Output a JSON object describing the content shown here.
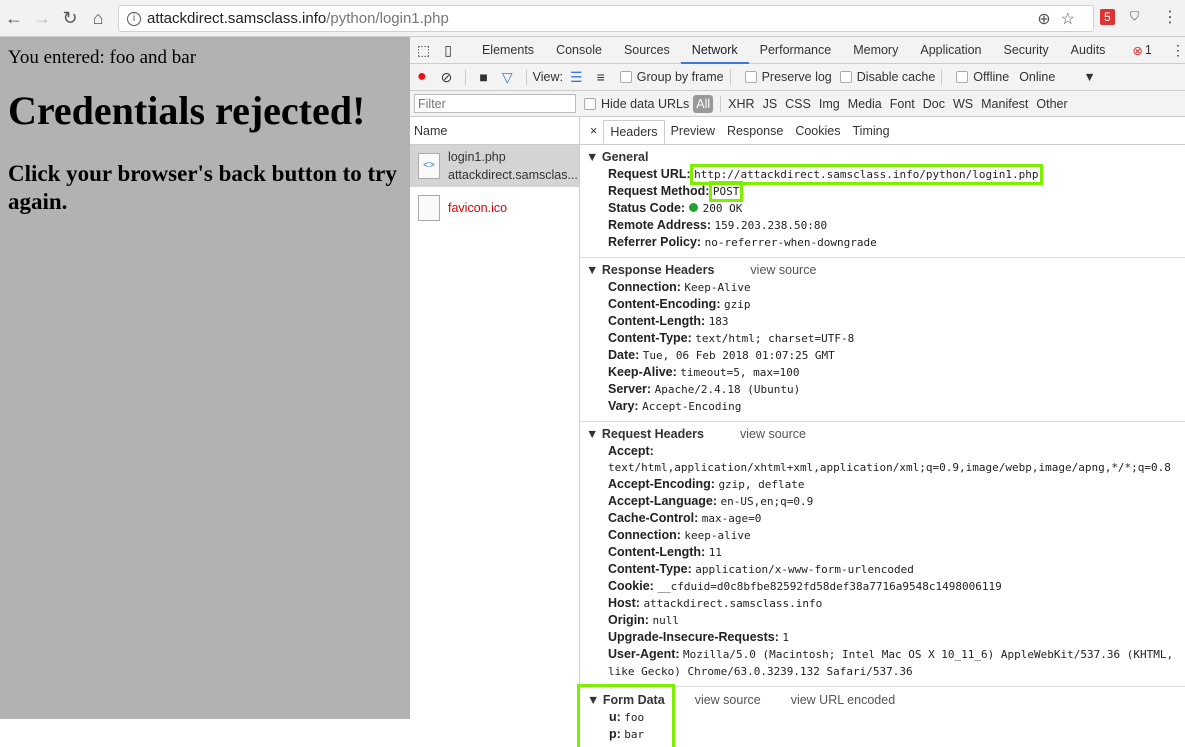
{
  "browser": {
    "url_host": "attackdirect.samsclass.info",
    "url_path": "/python/login1.php",
    "ext_badge": "5"
  },
  "page": {
    "entered": "You entered: foo and bar",
    "heading": "Credentials rejected!",
    "hint": "Click your browser's back button to try again."
  },
  "devtools": {
    "tabs": [
      "Elements",
      "Console",
      "Sources",
      "Network",
      "Performance",
      "Memory",
      "Application",
      "Security",
      "Audits"
    ],
    "error_count": "1",
    "toolbar": {
      "view": "View:",
      "group_by_frame": "Group by frame",
      "preserve_log": "Preserve log",
      "disable_cache": "Disable cache",
      "offline": "Offline",
      "throttle": "Online"
    },
    "filter_placeholder": "Filter",
    "hide_data_urls": "Hide data URLs",
    "filter_types": [
      "All",
      "XHR",
      "JS",
      "CSS",
      "Img",
      "Media",
      "Font",
      "Doc",
      "WS",
      "Manifest",
      "Other"
    ],
    "name_header": "Name",
    "requests": [
      {
        "name": "login1.php",
        "domain": "attackdirect.samsclas..."
      },
      {
        "name": "favicon.ico"
      }
    ],
    "detail_tabs": [
      "Headers",
      "Preview",
      "Response",
      "Cookies",
      "Timing"
    ],
    "general": {
      "title": "General",
      "items": [
        [
          "Request URL:",
          "http://attackdirect.samsclass.info/python/login1.php"
        ],
        [
          "Request Method:",
          "POST"
        ],
        [
          "Status Code:",
          "200 OK"
        ],
        [
          "Remote Address:",
          "159.203.238.50:80"
        ],
        [
          "Referrer Policy:",
          "no-referrer-when-downgrade"
        ]
      ]
    },
    "response_headers": {
      "title": "Response Headers",
      "view_source": "view source",
      "items": [
        [
          "Connection:",
          "Keep-Alive"
        ],
        [
          "Content-Encoding:",
          "gzip"
        ],
        [
          "Content-Length:",
          "183"
        ],
        [
          "Content-Type:",
          "text/html; charset=UTF-8"
        ],
        [
          "Date:",
          "Tue, 06 Feb 2018 01:07:25 GMT"
        ],
        [
          "Keep-Alive:",
          "timeout=5, max=100"
        ],
        [
          "Server:",
          "Apache/2.4.18 (Ubuntu)"
        ],
        [
          "Vary:",
          "Accept-Encoding"
        ]
      ]
    },
    "request_headers": {
      "title": "Request Headers",
      "view_source": "view source",
      "items": [
        [
          "Accept:",
          "text/html,application/xhtml+xml,application/xml;q=0.9,image/webp,image/apng,*/*;q=0.8"
        ],
        [
          "Accept-Encoding:",
          "gzip, deflate"
        ],
        [
          "Accept-Language:",
          "en-US,en;q=0.9"
        ],
        [
          "Cache-Control:",
          "max-age=0"
        ],
        [
          "Connection:",
          "keep-alive"
        ],
        [
          "Content-Length:",
          "11"
        ],
        [
          "Content-Type:",
          "application/x-www-form-urlencoded"
        ],
        [
          "Cookie:",
          "__cfduid=d0c8bfbe82592fd58def38a7716a9548c1498006119"
        ],
        [
          "Host:",
          "attackdirect.samsclass.info"
        ],
        [
          "Origin:",
          "null"
        ],
        [
          "Upgrade-Insecure-Requests:",
          "1"
        ],
        [
          "User-Agent:",
          "Mozilla/5.0 (Macintosh; Intel Mac OS X 10_11_6) AppleWebKit/537.36 (KHTML, like Gecko) Chrome/63.0.3239.132 Safari/537.36"
        ]
      ]
    },
    "form_data": {
      "title": "Form Data",
      "view_source": "view source",
      "view_url_encoded": "view URL encoded",
      "items": [
        [
          "u:",
          "foo"
        ],
        [
          "p:",
          "bar"
        ]
      ]
    }
  }
}
